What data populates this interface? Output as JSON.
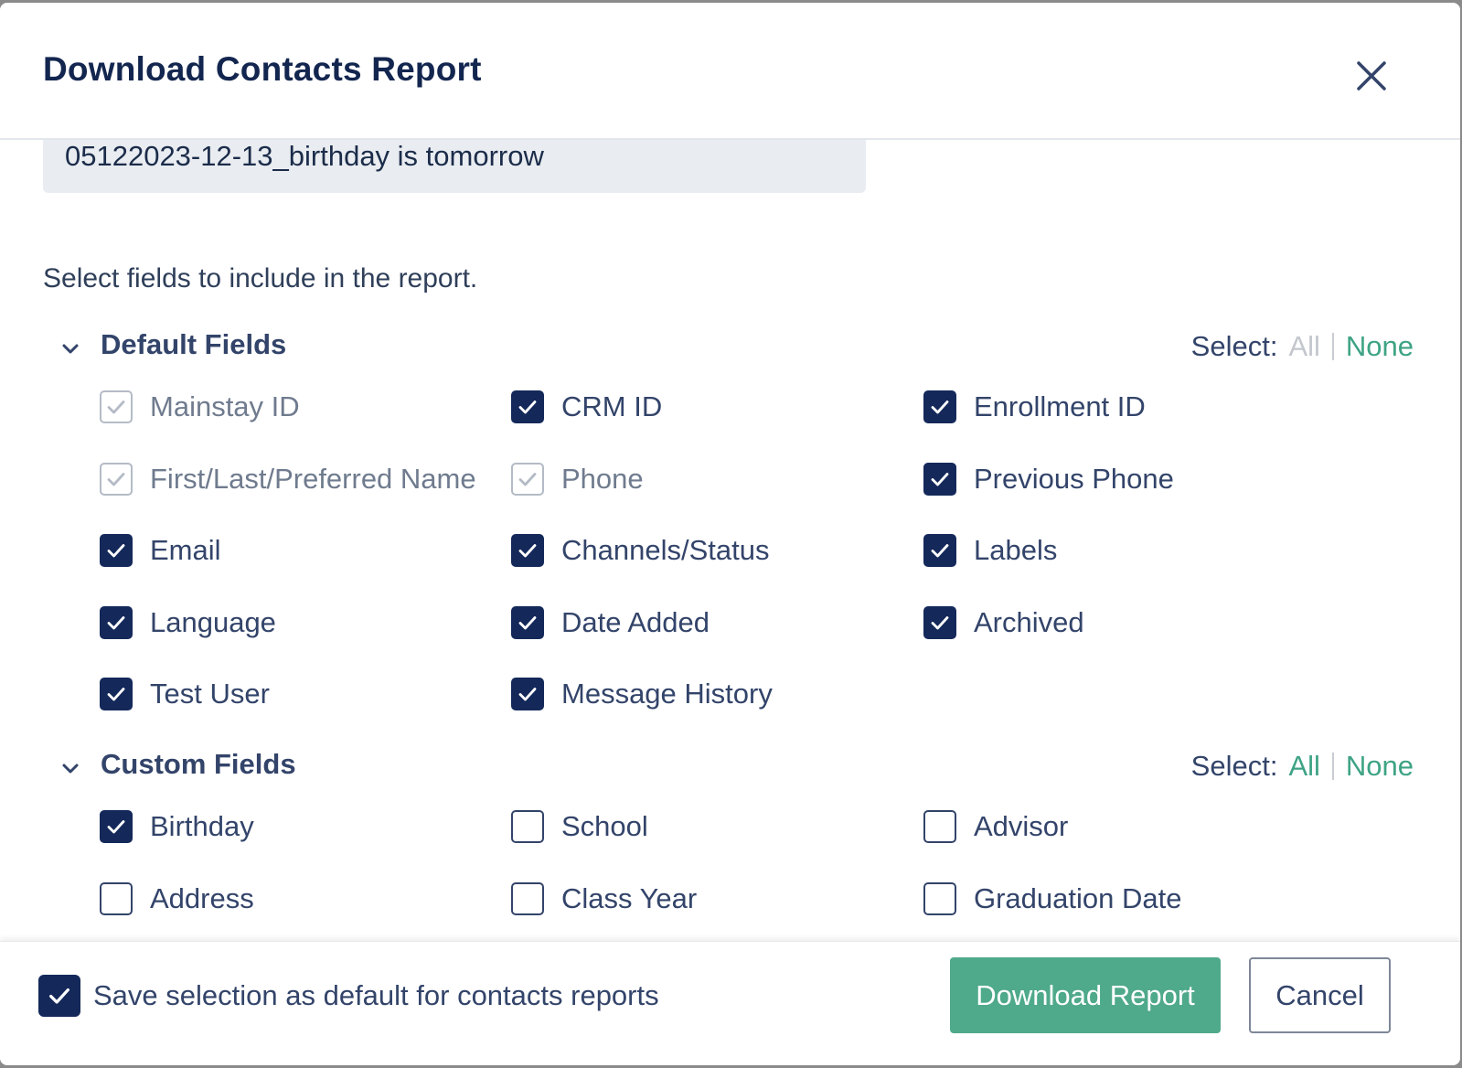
{
  "dialog": {
    "title": "Download Contacts Report",
    "close_icon": "close-icon"
  },
  "report_name": {
    "value": "05122023-12-13_birthday is tomorrow"
  },
  "instructions": "Select fields to include in the report.",
  "default_fields": {
    "title": "Default Fields",
    "select_label": "Select:",
    "all_label": "All",
    "none_label": "None",
    "all_enabled": false,
    "none_enabled": true,
    "fields": [
      {
        "label": "Mainstay ID",
        "state": "disabled-checked"
      },
      {
        "label": "CRM ID",
        "state": "checked"
      },
      {
        "label": "Enrollment ID",
        "state": "checked"
      },
      {
        "label": "First/Last/Preferred Name",
        "state": "disabled-checked"
      },
      {
        "label": "Phone",
        "state": "disabled-checked"
      },
      {
        "label": "Previous Phone",
        "state": "checked"
      },
      {
        "label": "Email",
        "state": "checked"
      },
      {
        "label": "Channels/Status",
        "state": "checked"
      },
      {
        "label": "Labels",
        "state": "checked"
      },
      {
        "label": "Language",
        "state": "checked"
      },
      {
        "label": "Date Added",
        "state": "checked"
      },
      {
        "label": "Archived",
        "state": "checked"
      },
      {
        "label": "Test User",
        "state": "checked"
      },
      {
        "label": "Message History",
        "state": "checked"
      }
    ]
  },
  "custom_fields": {
    "title": "Custom Fields",
    "select_label": "Select:",
    "all_label": "All",
    "none_label": "None",
    "all_enabled": true,
    "none_enabled": true,
    "fields": [
      {
        "label": "Birthday",
        "state": "checked"
      },
      {
        "label": "School",
        "state": "unchecked"
      },
      {
        "label": "Advisor",
        "state": "unchecked"
      },
      {
        "label": "Address",
        "state": "unchecked"
      },
      {
        "label": "Class Year",
        "state": "unchecked"
      },
      {
        "label": "Graduation Date",
        "state": "unchecked"
      }
    ]
  },
  "footer": {
    "save_default_label": "Save selection as default for contacts reports",
    "save_default_checked": true,
    "download_label": "Download Report",
    "cancel_label": "Cancel"
  },
  "colors": {
    "primary_navy": "#14295a",
    "accent_green": "#4fa98b",
    "link_green": "#3ea385",
    "text": "#33446a"
  }
}
